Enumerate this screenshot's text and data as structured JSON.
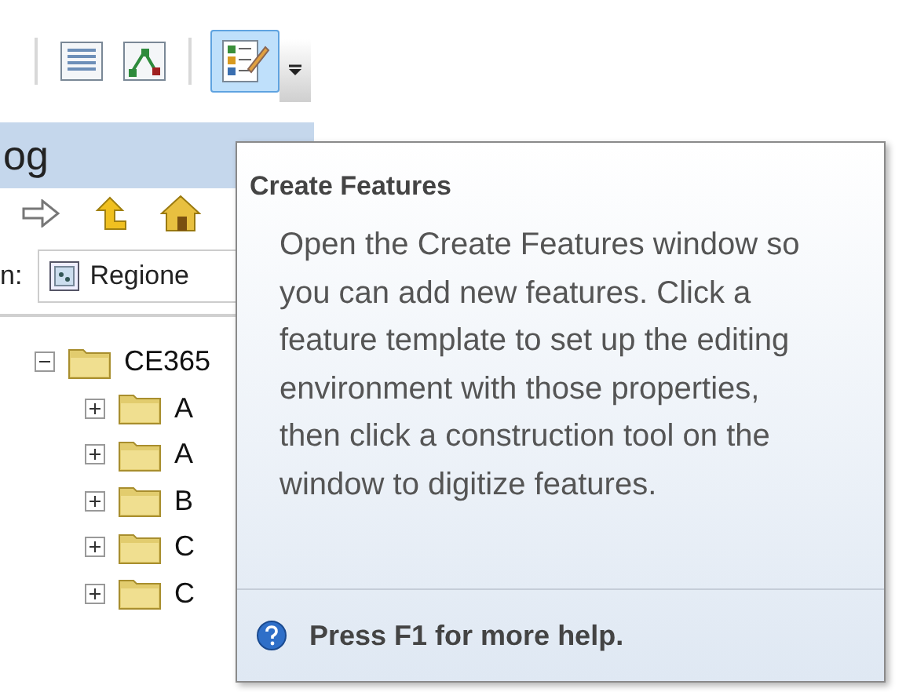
{
  "toolbar": {
    "buttons": [
      {
        "selected": false
      },
      {
        "selected": false
      },
      {
        "selected": true
      }
    ]
  },
  "catalog": {
    "title": "og",
    "location": {
      "label": "n:",
      "value": "Regione"
    },
    "tree": [
      {
        "label": "CE365",
        "expanded": true,
        "children": [
          {
            "label": "A",
            "expanded": false
          },
          {
            "label": "A",
            "expanded": false
          },
          {
            "label": "B",
            "expanded": false
          },
          {
            "label": "C",
            "expanded": false
          },
          {
            "label": "C",
            "expanded": false
          }
        ]
      }
    ]
  },
  "tooltip": {
    "title": "Create Features",
    "description": "Open the Create Features window so you can add new features. Click a feature template to set up the editing environment with those properties, then click a construction tool on the window to digitize features.",
    "help": "Press F1 for more help."
  }
}
